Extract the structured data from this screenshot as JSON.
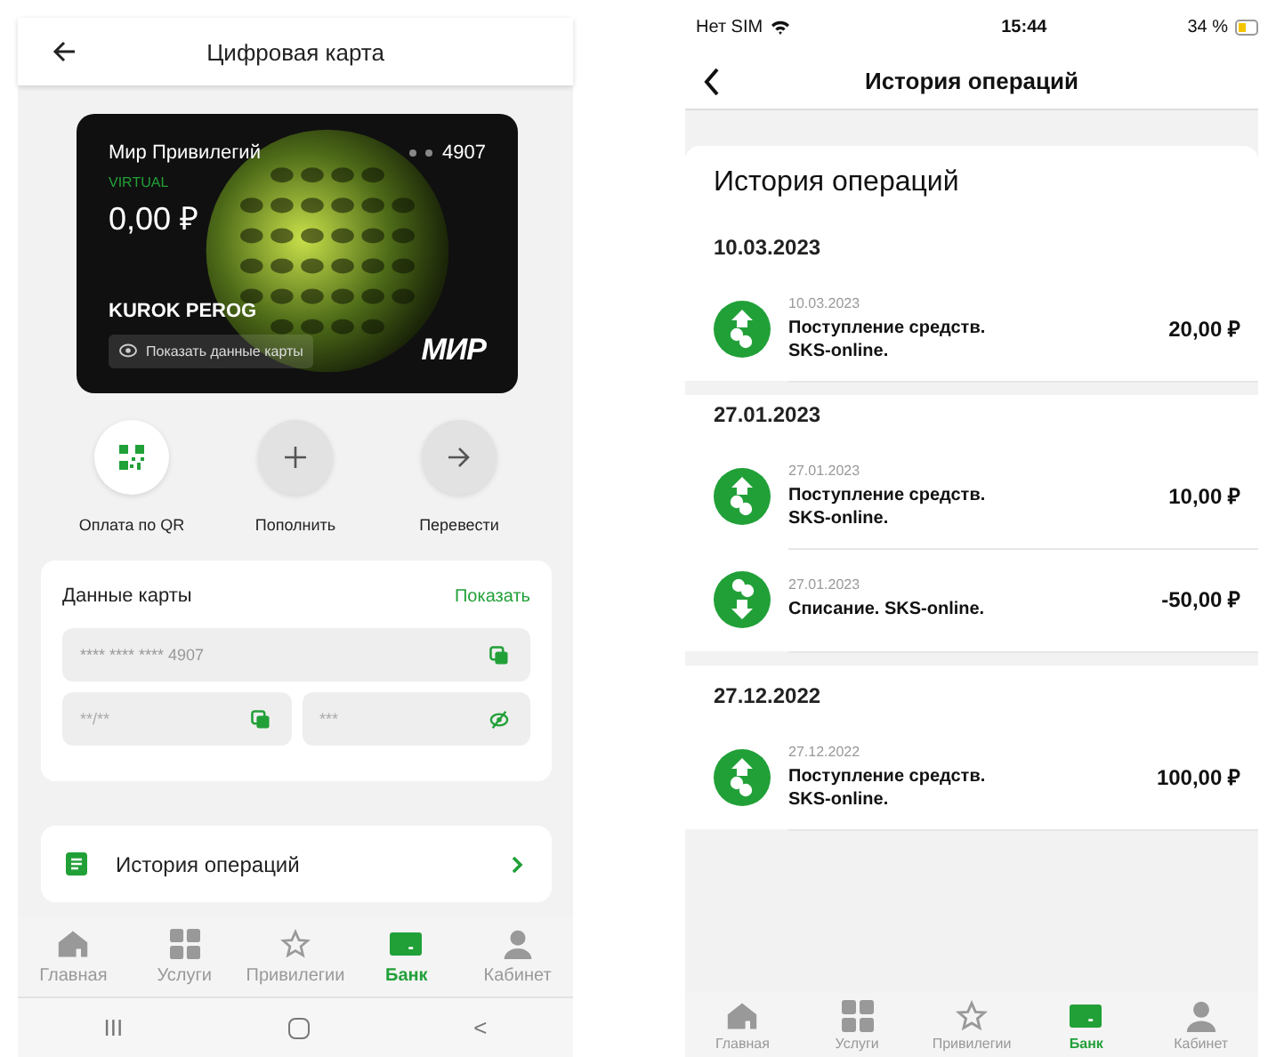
{
  "left_phone": {
    "header": {
      "title": "Цифровая карта"
    },
    "card": {
      "product": "Мир Привилегий",
      "type": "VIRTUAL",
      "balance": "0,00 ₽",
      "last_digits": "4907",
      "holder": "KUROK PEROG",
      "show_details": "Показать данные карты",
      "brand": "МИР"
    },
    "actions": [
      {
        "label": "Оплата по QR",
        "kind": "qr"
      },
      {
        "label": "Пополнить",
        "kind": "plus"
      },
      {
        "label": "Перевести",
        "kind": "arrow"
      }
    ],
    "card_data": {
      "title": "Данные карты",
      "show_link": "Показать",
      "number": "**** **** **** 4907",
      "expiry": "**/**",
      "cvc": "***"
    },
    "history_link": {
      "label": "История операций"
    },
    "bottom_nav": [
      {
        "label": "Главная",
        "selected": false
      },
      {
        "label": "Услуги",
        "selected": false
      },
      {
        "label": "Привилегии",
        "selected": false
      },
      {
        "label": "Банк",
        "selected": true
      },
      {
        "label": "Кабинет",
        "selected": false
      }
    ],
    "system_nav": {
      "recent": "III",
      "back": "<"
    }
  },
  "right_phone": {
    "status_bar": {
      "carrier": "Нет SIM",
      "time": "15:44",
      "battery": "34 %"
    },
    "header": {
      "title": "История операций"
    },
    "heading": "История операций",
    "groups": [
      {
        "date": "10.03.2023",
        "operations": [
          {
            "kind": "in",
            "date": "10.03.2023",
            "title": "Поступление средств. SKS-online.",
            "amount": "20,00 ₽"
          }
        ]
      },
      {
        "date": "27.01.2023",
        "operations": [
          {
            "kind": "in",
            "date": "27.01.2023",
            "title": "Поступление средств. SKS-online.",
            "amount": "10,00 ₽"
          },
          {
            "kind": "out",
            "date": "27.01.2023",
            "title": "Списание. SKS-online.",
            "amount": "-50,00 ₽"
          }
        ]
      },
      {
        "date": "27.12.2022",
        "operations": [
          {
            "kind": "in",
            "date": "27.12.2022",
            "title": "Поступление средств. SKS-online.",
            "amount": "100,00 ₽"
          }
        ]
      }
    ],
    "bottom_nav": [
      {
        "label": "Главная",
        "selected": false
      },
      {
        "label": "Услуги",
        "selected": false
      },
      {
        "label": "Привилегии",
        "selected": false
      },
      {
        "label": "Банк",
        "selected": true
      },
      {
        "label": "Кабинет",
        "selected": false
      }
    ]
  }
}
